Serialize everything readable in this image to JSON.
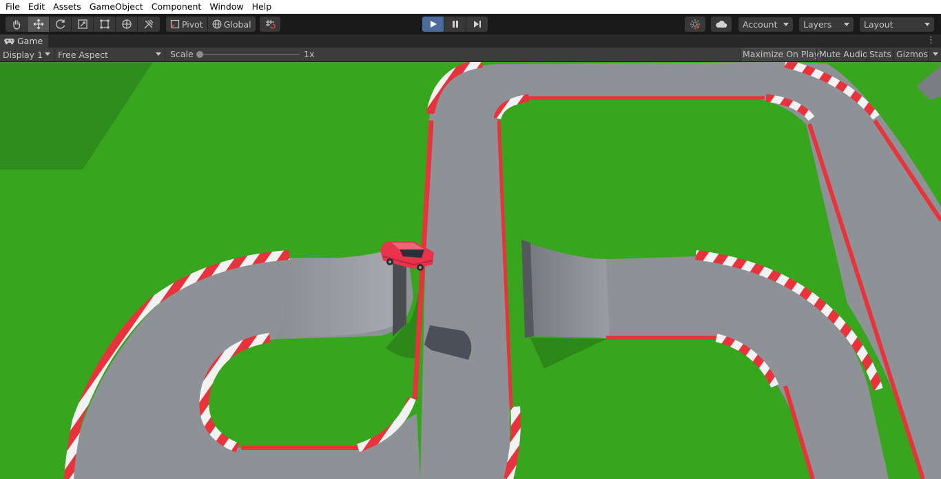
{
  "menu": [
    "File",
    "Edit",
    "Assets",
    "GameObject",
    "Component",
    "Window",
    "Help"
  ],
  "toolbar": {
    "tools": [
      "hand-tool-icon",
      "move-tool-icon",
      "rotate-tool-icon",
      "scale-tool-icon",
      "rect-tool-icon",
      "transform-tool-icon",
      "custom-tool-icon"
    ],
    "pivot_label": "Pivot",
    "global_label": "Global",
    "account_label": "Account",
    "layers_label": "Layers",
    "layout_label": "Layout"
  },
  "game_tab": {
    "label": "Game"
  },
  "game_bar": {
    "display": "Display 1",
    "aspect": "Free Aspect",
    "scale_label": "Scale",
    "scale_value": "1x",
    "maximize_label": "Maximize On Play",
    "mute_label": "Mute Audio",
    "stats_label": "Stats",
    "gizmos_label": "Gizmos"
  },
  "colors": {
    "grass": "#37a51d",
    "road": "#8e9196",
    "curb_red": "#e8323c",
    "curb_white": "#f2f2f2",
    "car": "#e8334a",
    "play_active": "#4c6c9e"
  }
}
